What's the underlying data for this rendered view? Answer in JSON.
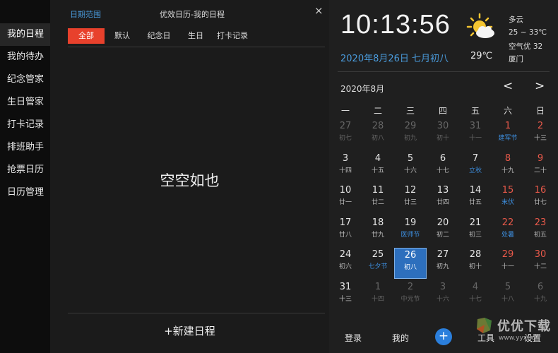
{
  "sidebar": {
    "items": [
      "我的日程",
      "我的待办",
      "纪念管家",
      "生日管家",
      "打卡记录",
      "排班助手",
      "抢票日历",
      "日历管理"
    ]
  },
  "main": {
    "date_range": "日期范围",
    "title": "优效日历-我的日程",
    "close": "×",
    "filters": [
      "全部",
      "默认",
      "纪念日",
      "生日",
      "打卡记录"
    ],
    "empty": "空空如也",
    "new_button": "+新建日程"
  },
  "clock": {
    "time": "10:13:56",
    "date": "2020年8月26日 七月初八"
  },
  "weather": {
    "temp": "29℃",
    "lines": [
      "多云",
      "25 ~ 33℃",
      "空气优 32",
      "厦门"
    ],
    "icon": "partly-cloudy-icon"
  },
  "calendar": {
    "month": "2020年8月",
    "prev": "<",
    "next": ">",
    "weekdays": [
      "一",
      "二",
      "三",
      "四",
      "五",
      "六",
      "日"
    ],
    "weeks": [
      [
        [
          "27",
          "初七",
          "dim"
        ],
        [
          "28",
          "初八",
          "dim"
        ],
        [
          "29",
          "初九",
          "dim"
        ],
        [
          "30",
          "初十",
          "dim"
        ],
        [
          "31",
          "十一",
          "dim"
        ],
        [
          "1",
          "建军节",
          "red fest"
        ],
        [
          "2",
          "十三",
          "red"
        ]
      ],
      [
        [
          "3",
          "十四",
          "cur"
        ],
        [
          "4",
          "十五",
          "cur"
        ],
        [
          "5",
          "十六",
          "cur"
        ],
        [
          "6",
          "十七",
          "cur"
        ],
        [
          "7",
          "立秋",
          "cur fest"
        ],
        [
          "8",
          "十九",
          "red"
        ],
        [
          "9",
          "二十",
          "red"
        ]
      ],
      [
        [
          "10",
          "廿一",
          "cur"
        ],
        [
          "11",
          "廿二",
          "cur"
        ],
        [
          "12",
          "廿三",
          "cur"
        ],
        [
          "13",
          "廿四",
          "cur"
        ],
        [
          "14",
          "廿五",
          "cur"
        ],
        [
          "15",
          "末伏",
          "red fest"
        ],
        [
          "16",
          "廿七",
          "red"
        ]
      ],
      [
        [
          "17",
          "廿八",
          "cur"
        ],
        [
          "18",
          "廿九",
          "cur"
        ],
        [
          "19",
          "医师节",
          "cur fest"
        ],
        [
          "20",
          "初二",
          "cur"
        ],
        [
          "21",
          "初三",
          "cur"
        ],
        [
          "22",
          "处暑",
          "red fest"
        ],
        [
          "23",
          "初五",
          "red"
        ]
      ],
      [
        [
          "24",
          "初六",
          "cur"
        ],
        [
          "25",
          "七夕节",
          "cur fest"
        ],
        [
          "26",
          "初八",
          "today"
        ],
        [
          "27",
          "初九",
          "cur"
        ],
        [
          "28",
          "初十",
          "cur"
        ],
        [
          "29",
          "十一",
          "red"
        ],
        [
          "30",
          "十二",
          "red"
        ]
      ],
      [
        [
          "31",
          "十三",
          "cur"
        ],
        [
          "1",
          "十四",
          "dim"
        ],
        [
          "2",
          "中元节",
          "dim"
        ],
        [
          "3",
          "十六",
          "dim"
        ],
        [
          "4",
          "十七",
          "dim"
        ],
        [
          "5",
          "十八",
          "dim"
        ],
        [
          "6",
          "十九",
          "dim"
        ]
      ]
    ]
  },
  "bottom": {
    "login": "登录",
    "mine": "我的",
    "plus": "+",
    "tools": "工具",
    "settings": "设置"
  },
  "watermark": {
    "text": "优优下载",
    "url": "www.yyxt.c"
  }
}
